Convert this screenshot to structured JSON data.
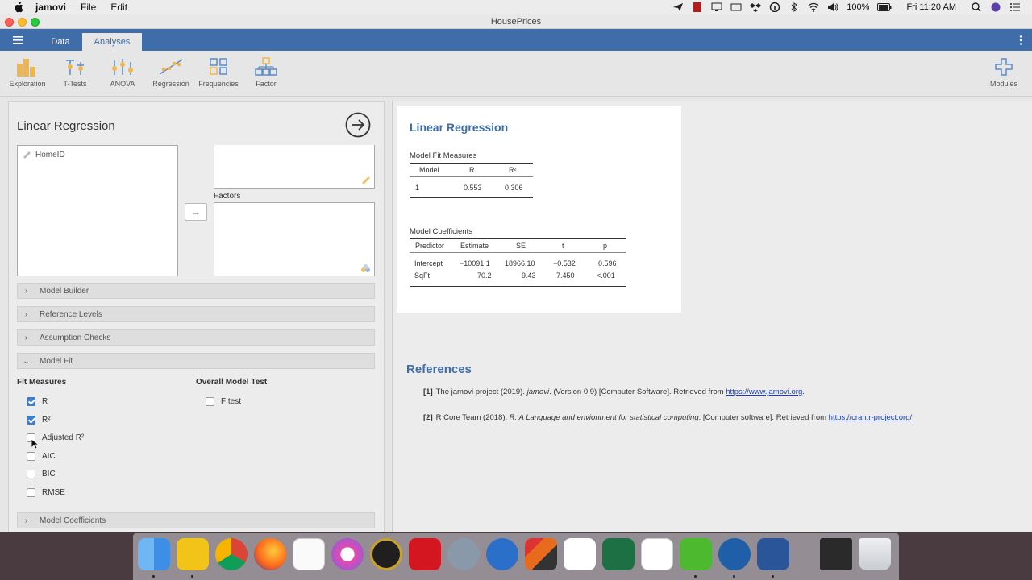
{
  "menubar": {
    "app_name": "jamovi",
    "items": [
      "File",
      "Edit"
    ],
    "battery": "100%",
    "clock": "Fri 11:20 AM"
  },
  "window": {
    "title": "HousePrices"
  },
  "tabs": {
    "data": "Data",
    "analyses": "Analyses"
  },
  "ribbon": {
    "exploration": "Exploration",
    "ttests": "T-Tests",
    "anova": "ANOVA",
    "regression": "Regression",
    "frequencies": "Frequencies",
    "factor": "Factor",
    "modules": "Modules"
  },
  "options": {
    "title": "Linear Regression",
    "variable": "HomeID",
    "factors_label": "Factors",
    "sections": {
      "model_builder": "Model Builder",
      "reference_levels": "Reference Levels",
      "assumption_checks": "Assumption Checks",
      "model_fit": "Model Fit",
      "model_coefficients": "Model Coefficients"
    },
    "fit_measures_heading": "Fit Measures",
    "overall_test_heading": "Overall Model Test",
    "fit_measures": {
      "r": "R",
      "r2": "R²",
      "adj_r2": "Adjusted R²",
      "aic": "AIC",
      "bic": "BIC",
      "rmse": "RMSE"
    },
    "f_test": "F test"
  },
  "results": {
    "title": "Linear Regression",
    "fit_caption": "Model Fit Measures",
    "fit_headers": [
      "Model",
      "R",
      "R²"
    ],
    "fit_row": [
      "1",
      "0.553",
      "0.306"
    ],
    "coef_caption": "Model Coefficients",
    "coef_headers": [
      "Predictor",
      "Estimate",
      "SE",
      "t",
      "p"
    ],
    "coef_rows": [
      [
        "Intercept",
        "−10091.1",
        "18966.10",
        "−0.532",
        "0.596"
      ],
      [
        "SqFt",
        "70.2",
        "9.43",
        "7.450",
        "<.001"
      ]
    ],
    "references_title": "References",
    "ref1": {
      "num": "[1]",
      "pre": "The jamovi project (2019). ",
      "ital": "jamovi",
      "post": ". (Version 0.9) [Computer Software]. Retrieved from ",
      "link": "https://www.jamovi.org",
      "end": "."
    },
    "ref2": {
      "num": "[2]",
      "pre": "R Core Team (2018). ",
      "ital": "R: A Language and envionment for statistical computing",
      "post": ". [Computer software]. Retrieved from ",
      "link": "https://cran.r-project.org/",
      "end": "."
    }
  },
  "colors": {
    "accent": "#3e6da9",
    "checkbox_on": "#3e7dc9"
  }
}
